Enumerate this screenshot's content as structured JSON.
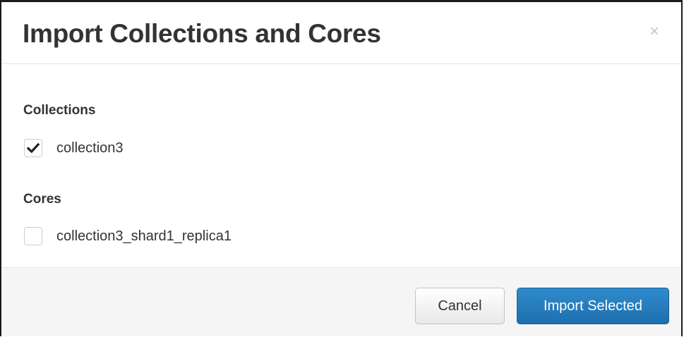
{
  "dialog": {
    "title": "Import Collections and Cores",
    "close_glyph": "×"
  },
  "collections": {
    "heading": "Collections",
    "items": [
      {
        "label": "collection3",
        "checked": true
      }
    ]
  },
  "cores": {
    "heading": "Cores",
    "items": [
      {
        "label": "collection3_shard1_replica1",
        "checked": false
      }
    ]
  },
  "footer": {
    "cancel_label": "Cancel",
    "import_label": "Import Selected"
  },
  "colors": {
    "primary": "#2a7fc0",
    "text": "#333333",
    "footer_bg": "#f5f5f5",
    "close": "#c8c8c8"
  },
  "icons": {
    "close": "close-icon",
    "check": "checkmark-icon"
  }
}
